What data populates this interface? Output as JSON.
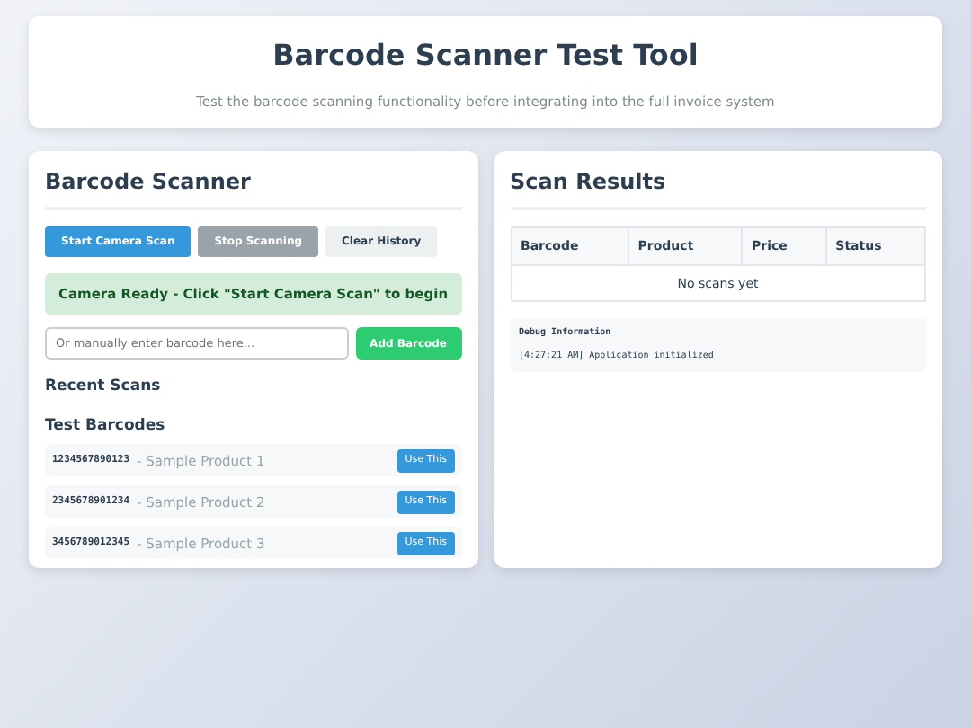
{
  "header": {
    "title": "Barcode Scanner Test Tool",
    "subtitle": "Test the barcode scanning functionality before integrating into the full invoice system"
  },
  "scanner": {
    "title": "Barcode Scanner",
    "buttons": [
      {
        "label": "Start Camera Scan",
        "kind": "primary",
        "disabled": false
      },
      {
        "label": "Stop Scanning",
        "kind": "danger",
        "disabled": true
      },
      {
        "label": "Clear History",
        "kind": "secondary",
        "disabled": false
      }
    ],
    "status": "Camera Ready - Click \"Start Camera Scan\" to begin",
    "manual": {
      "placeholder": "Or manually enter barcode here...",
      "button": "Add Barcode"
    },
    "recent_title": "Recent Scans",
    "test_title": "Test Barcodes",
    "test_barcodes": [
      {
        "code": "1234567890123",
        "product": "- Sample Product 1",
        "button": "Use This"
      },
      {
        "code": "2345678901234",
        "product": "- Sample Product 2",
        "button": "Use This"
      },
      {
        "code": "3456789012345",
        "product": "- Sample Product 3",
        "button": "Use This"
      }
    ]
  },
  "results": {
    "title": "Scan Results",
    "table": {
      "columns": [
        "Barcode",
        "Product",
        "Price",
        "Status"
      ],
      "empty": "No scans yet"
    },
    "debug": {
      "title": "Debug Information",
      "lines": [
        "[4:27:21 AM] Application initialized"
      ]
    }
  }
}
